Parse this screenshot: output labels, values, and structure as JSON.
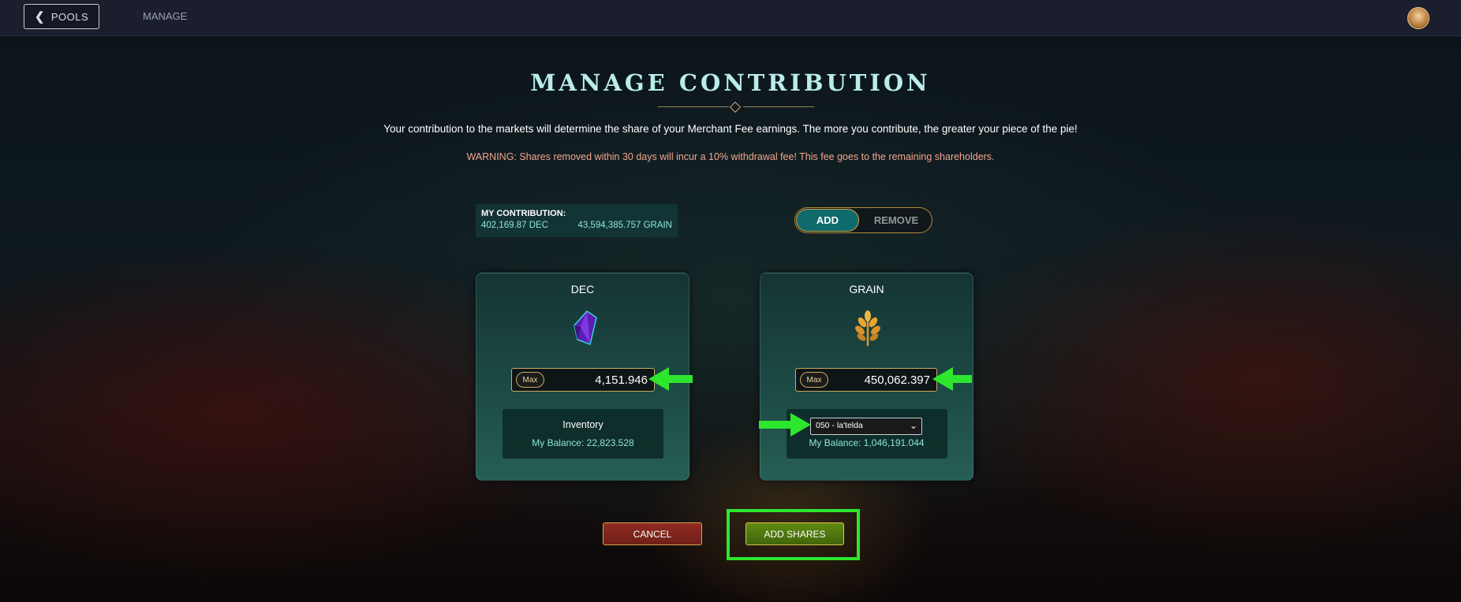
{
  "topbar": {
    "back_label": "POOLS",
    "back_icon": "chevron-left-icon",
    "manage_label": "MANAGE",
    "avatar_icon": "avatar-icon"
  },
  "heading": {
    "title": "MANAGE CONTRIBUTION",
    "description": "Your contribution to the markets will determine the share of your Merchant Fee earnings. The more you contribute, the greater your piece of the pie!",
    "warning": "WARNING: Shares removed within 30 days will incur a 10% withdrawal fee! This fee goes to the remaining shareholders."
  },
  "contribution": {
    "label": "MY CONTRIBUTION:",
    "dec": "402,169.87 DEC",
    "grain": "43,594,385.757 GRAIN"
  },
  "mode_toggle": {
    "add_label": "ADD",
    "remove_label": "REMOVE",
    "active": "ADD"
  },
  "dec_card": {
    "title": "DEC",
    "icon": "crystal-icon",
    "max_label": "Max",
    "amount": "4,151.946",
    "panel_title": "Inventory",
    "balance": "My Balance: 22,823.528"
  },
  "grain_card": {
    "title": "GRAIN",
    "icon": "wheat-icon",
    "max_label": "Max",
    "amount": "450,062.397",
    "selected_source": "050 - la'telda",
    "balance": "My Balance: 1,046,191.044"
  },
  "actions": {
    "cancel_label": "CANCEL",
    "add_shares_label": "ADD SHARES"
  },
  "colors": {
    "title": "#b9ecea",
    "warning": "#f2a58f",
    "accent_teal": "#0f6a6c",
    "annotation_green": "#2ee62e"
  }
}
